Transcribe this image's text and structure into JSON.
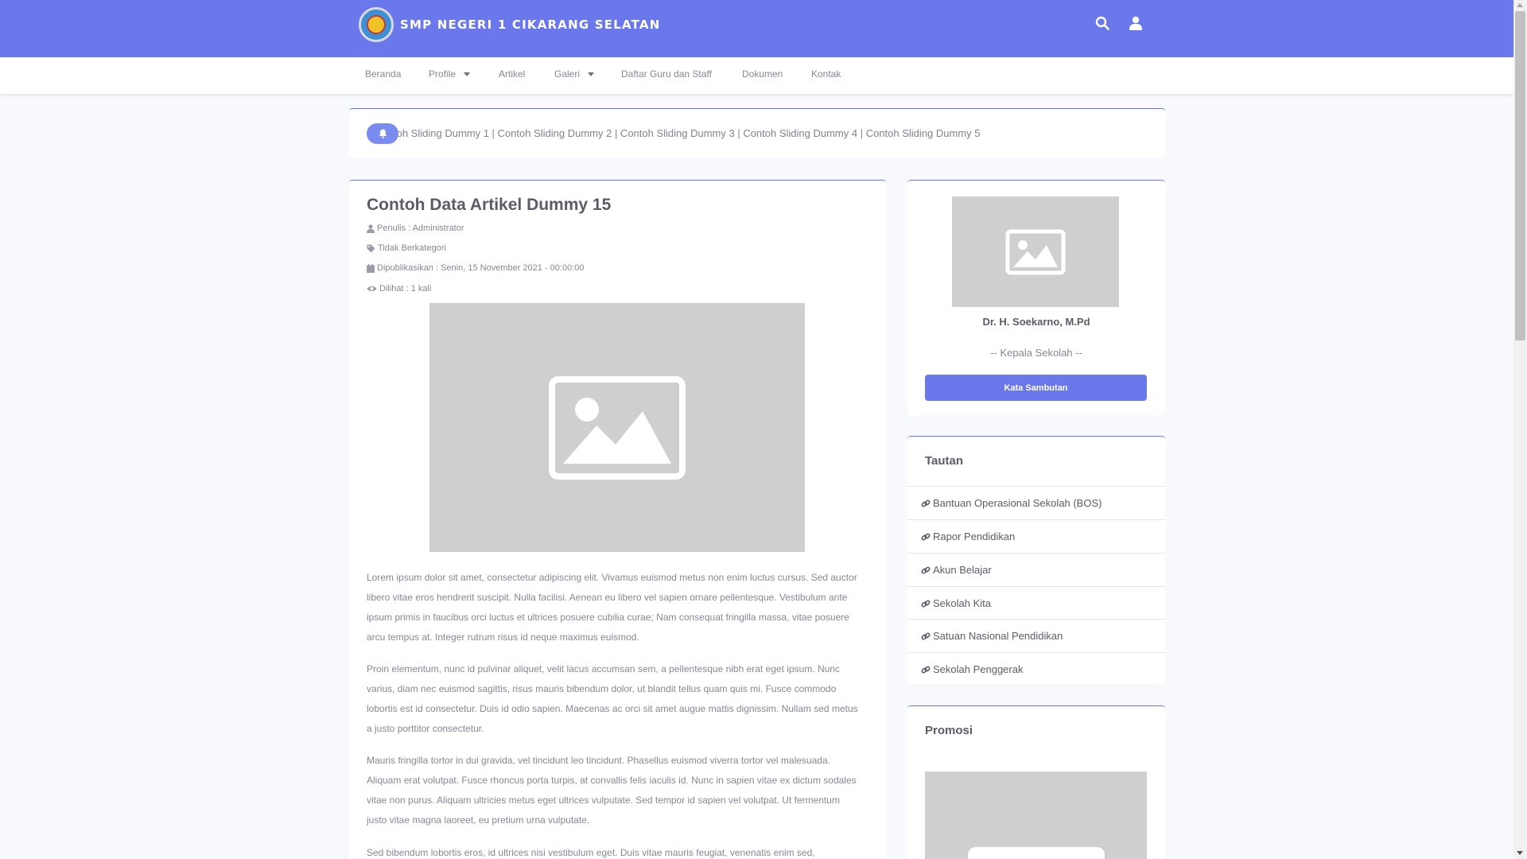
{
  "header": {
    "school_name": "SMP NEGERI 1 CIKARANG SELATAN"
  },
  "nav": {
    "items": [
      {
        "label": "Beranda",
        "dropdown": false
      },
      {
        "label": "Profile",
        "dropdown": true
      },
      {
        "label": "Artikel",
        "dropdown": false
      },
      {
        "label": "Galeri",
        "dropdown": true
      },
      {
        "label": "Daftar Guru dan Staff",
        "dropdown": false
      },
      {
        "label": "Dokumen",
        "dropdown": false
      },
      {
        "label": "Kontak",
        "dropdown": false
      }
    ]
  },
  "ticker": {
    "text": "toh Sliding Dummy 1 | Contoh Sliding Dummy 2 | Contoh Sliding Dummy 3 | Contoh Sliding Dummy 4 | Contoh Sliding Dummy 5"
  },
  "article": {
    "title": "Contoh Data Artikel Dummy 15",
    "author": "Penulis : Administrator",
    "category": "Tidak Berkategori",
    "published": "Dipublikasikan : Senin, 15 November 2021 - 00:00:00",
    "views": "Dilihat : 1 kali",
    "paragraphs": [
      "Lorem ipsum dolor sit amet, consectetur adipiscing elit. Vivamus euismod metus non enim luctus cursus. Sed auctor libero vitae eros hendrerit suscipit. Nulla facilisi. Aenean eu libero vel sapien ornare pellentesque. Vestibulum ante ipsum primis in faucibus orci luctus et ultrices posuere cubilia curae; Nam consequat fringilla massa, vitae posuere arcu tempus at. Integer rutrum risus id neque maximus euismod.",
      "Proin elementum, nunc id pulvinar aliquet, velit lacus accumsan sem, a pellentesque nibh erat eget ipsum. Nunc varius, diam nec euismod sagittis, risus mauris bibendum dolor, ut blandit tellus quam quis mi. Fusce commodo lobortis est id consectetur. Duis id odio sapien. Maecenas ac orci sit amet augue mattis dignissim. Nullam sed metus a justo porttitor consectetur.",
      "Mauris fringilla tortor in dui gravida, vel tincidunt leo tincidunt. Phasellus euismod viverra tortor vel malesuada. Aliquam erat volutpat. Fusce rhoncus porta turpis, at convallis felis iaculis id. Nunc in sapien vitae ex dictum sodales vitae non purus. Aliquam ultricies metus eget ultrices vulputate. Sed tempor id sapien vel volutpat. Ut fermentum justo vitae magna laoreet, eu pretium urna vulputate.",
      "Sed bibendum lobortis eros, id ultrices nisi vestibulum eget. Duis vitae mauris feugiat, venenatis enim sed,"
    ]
  },
  "principal": {
    "name": "Dr. H. Soekarno, M.Pd",
    "role": "-- Kepala Sekolah --",
    "button": "Kata Sambutan"
  },
  "links": {
    "title": "Tautan",
    "items": [
      "Bantuan Operasional Sekolah (BOS)",
      "Rapor Pendidikan",
      "Akun Belajar",
      "Sekolah Kita",
      "Satuan Nasional Pendidikan",
      "Sekolah Penggerak"
    ]
  },
  "promo": {
    "title": "Promosi"
  },
  "colors": {
    "primary": "#6a78ec",
    "background": "#f8f9fc",
    "placeholder": "#cfcfcf",
    "text": "#858796",
    "heading": "#5a5c69"
  },
  "icons": {
    "search": "search-icon",
    "user": "user-icon",
    "bell": "bell-icon",
    "link": "link-icon"
  }
}
